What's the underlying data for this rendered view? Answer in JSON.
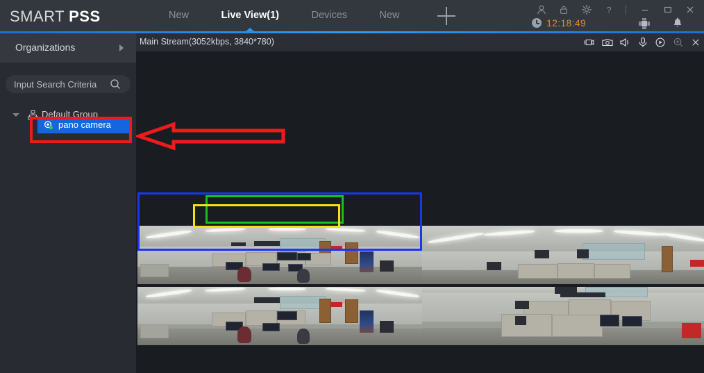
{
  "app": {
    "brand_primary": "SMART",
    "brand_secondary": "PSS",
    "accent_color": "#1e88e5",
    "active_tab_color": "#2f95e8"
  },
  "header": {
    "tabs": [
      {
        "label": "New",
        "active": false
      },
      {
        "label": "Live View(1)",
        "active": true
      },
      {
        "label": "Devices",
        "active": false
      },
      {
        "label": "New",
        "active": false
      }
    ],
    "add_tab_label": "+",
    "window_icons": [
      {
        "name": "user-icon",
        "title": "User"
      },
      {
        "name": "lock-icon",
        "title": "Lock"
      },
      {
        "name": "gear-icon",
        "title": "Settings"
      },
      {
        "name": "help-icon",
        "title": "Help"
      },
      {
        "name": "minimize-icon",
        "title": "Minimize"
      },
      {
        "name": "maximize-icon",
        "title": "Maximize"
      },
      {
        "name": "close-icon",
        "title": "Close"
      }
    ],
    "clock": "12:18:49",
    "clock_color": "#e08b2a",
    "cpu_icon": "cpu-icon",
    "bell_icon": "bell-icon"
  },
  "sidebar": {
    "panel_title": "Organizations",
    "search": {
      "placeholder": "Input Search Criteria",
      "value": "",
      "icon": "search-icon"
    },
    "tree": {
      "group_label": "Default Group",
      "group_icon": "org-tree-icon",
      "expanded": true,
      "devices": [
        {
          "label": "pano camera",
          "icon": "camera-icon",
          "status": "online",
          "status_color": "#2ecc40",
          "selected": true
        }
      ]
    }
  },
  "main": {
    "stream_label": "Main Stream(3052kbps, 3840*780)",
    "toolbar": [
      {
        "name": "record-icon",
        "title": "Record"
      },
      {
        "name": "snapshot-icon",
        "title": "Snapshot"
      },
      {
        "name": "audio-icon",
        "title": "Audio"
      },
      {
        "name": "talk-icon",
        "title": "Talk"
      },
      {
        "name": "instant-playback-icon",
        "title": "Instant Playback"
      },
      {
        "name": "zoom-icon",
        "title": "Digital Zoom"
      },
      {
        "name": "close-window-icon",
        "title": "Close"
      }
    ],
    "panes": [
      {
        "id": "pano-view",
        "title": "Panoramic View",
        "selected": true
      },
      {
        "id": "detail-view-1",
        "title": "Detail View 1",
        "selected": false
      },
      {
        "id": "pano-view-2",
        "title": "Panoramic View 2",
        "selected": false
      },
      {
        "id": "detail-view-2",
        "title": "Detail View 2",
        "selected": false
      }
    ],
    "overlays": {
      "selection_color": "#1b36f0",
      "region_green_color": "#15c21a",
      "region_yellow_color": "#f2e216"
    }
  },
  "annotations": {
    "highlight_box_color": "#ee1b1b",
    "arrow_color": "#ee1b1b",
    "arrow_direction": "left",
    "target": "pano camera"
  }
}
